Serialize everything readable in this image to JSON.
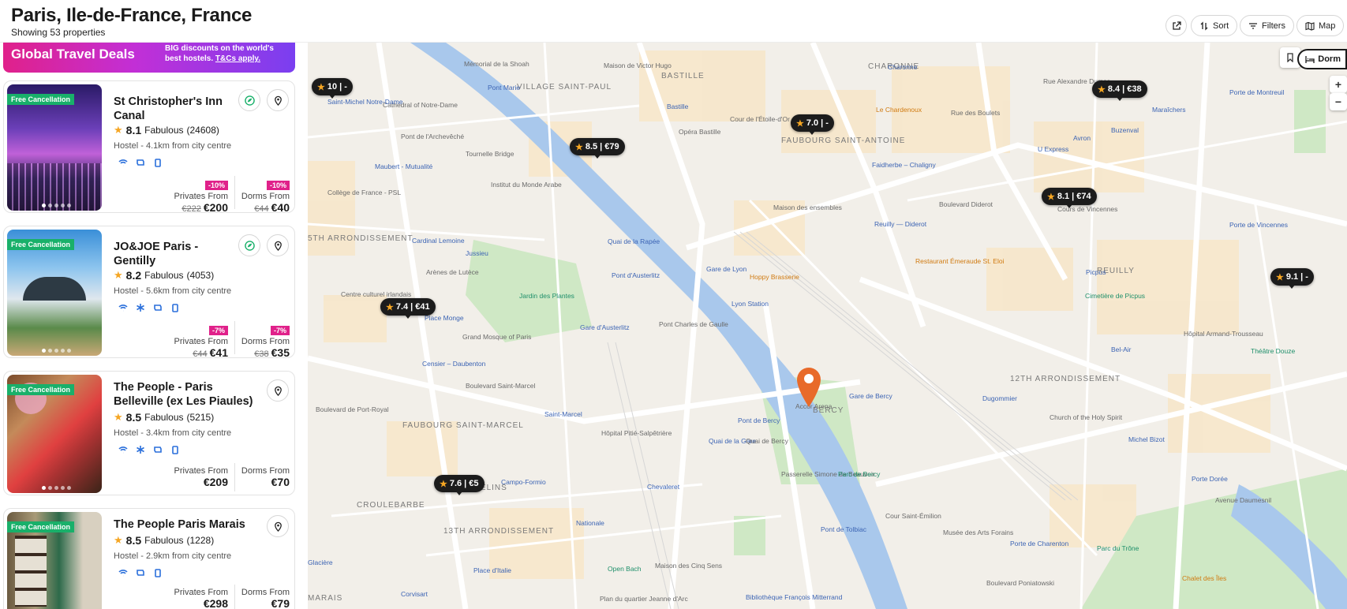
{
  "header": {
    "title": "Paris, Ile-de-France, France",
    "subtitle": "Showing 53 properties",
    "sort_label": "Sort",
    "filters_label": "Filters",
    "map_label": "Map"
  },
  "banner": {
    "headline": "Global Travel Deals",
    "text": "BIG discounts on the world's best hostels.",
    "link": "T&Cs apply."
  },
  "properties": [
    {
      "badge": "Free Cancellation",
      "name": "St Christopher's Inn Canal",
      "score": "8.1",
      "rating_word": "Fabulous",
      "reviews": "(24608)",
      "meta": "Hostel - 4.1km from city centre",
      "privates_discount": "-10%",
      "privates_label": "Privates From",
      "privates_old": "€222",
      "privates_price": "€200",
      "dorms_discount": "-10%",
      "dorms_label": "Dorms From",
      "dorms_old": "€44",
      "dorms_price": "€40"
    },
    {
      "badge": "Free Cancellation",
      "name": "JO&JOE Paris - Gentilly",
      "score": "8.2",
      "rating_word": "Fabulous",
      "reviews": "(4053)",
      "meta": "Hostel - 5.6km from city centre",
      "privates_discount": "-7%",
      "privates_label": "Privates From",
      "privates_old": "€44",
      "privates_price": "€41",
      "dorms_discount": "-7%",
      "dorms_label": "Dorms From",
      "dorms_old": "€38",
      "dorms_price": "€35"
    },
    {
      "badge": "Free Cancellation",
      "name": "The People - Paris Belleville (ex Les Piaules)",
      "score": "8.5",
      "rating_word": "Fabulous",
      "reviews": "(5215)",
      "meta": "Hostel - 3.4km from city centre",
      "privates_label": "Privates From",
      "privates_price": "€209",
      "dorms_label": "Dorms From",
      "dorms_price": "€70"
    },
    {
      "badge": "Free Cancellation",
      "name": "The People Paris Marais",
      "score": "8.5",
      "rating_word": "Fabulous",
      "reviews": "(1228)",
      "meta": "Hostel - 2.9km from city centre",
      "privates_label": "Privates From",
      "privates_price": "€298",
      "dorms_label": "Dorms From",
      "dorms_price": "€79"
    }
  ],
  "map": {
    "dorm_toggle": "Dorm",
    "zoom_in": "+",
    "zoom_out": "−",
    "pins": [
      {
        "score": "10",
        "price": "-"
      },
      {
        "score": "8.5",
        "price": "€79"
      },
      {
        "score": "7.0",
        "price": "-"
      },
      {
        "score": "8.4",
        "price": "€38"
      },
      {
        "score": "8.1",
        "price": "€74"
      },
      {
        "score": "9.1",
        "price": "-"
      },
      {
        "score": "7.4",
        "price": "€41"
      },
      {
        "score": "7.6",
        "price": "€5"
      }
    ],
    "areas": [
      "BASTILLE",
      "VILLAGE SAINT-PAUL",
      "FAUBOURG SAINT-ANTOINE",
      "CHARONNE",
      "REUILLY",
      "12TH ARRONDISSEMENT",
      "BERCY",
      "5TH ARRONDISSEMENT",
      "FAUBOURG SAINT-MARCEL",
      "CROULEBARBE",
      "LES GOBELINS",
      "13TH ARRONDISSEMENT",
      "MARAIS"
    ],
    "places": [
      "Mémorial de la Shoah",
      "Maison de Victor Hugo",
      "Pont Marie",
      "Cathedral of Notre-Dame",
      "Saint-Michel Notre-Dame",
      "Pont de l'Archevêché",
      "Tournelle Bridge",
      "Maubert - Mutualité",
      "Institut du Monde Arabe",
      "Collège de France - PSL",
      "Bastille",
      "Opéra Bastille",
      "Cour de l'Étoile-d'Or",
      "Le Chardenoux",
      "Rue des Boulets",
      "Charonne",
      "U Express",
      "Buzenval",
      "Maraîchers",
      "Porte de Montreuil",
      "Faidherbe – Chaligny",
      "Maison des ensembles",
      "Reuilly — Diderot",
      "Restaurant Émeraude St. Eloi",
      "Picpus",
      "Cimetière de Picpus",
      "Porte de Vincennes",
      "Gare de Lyon",
      "Hoppy Brasserie",
      "Lyon Station",
      "Quai de la Rapée",
      "Pont d'Austerlitz",
      "Jardin des Plantes",
      "Arènes de Lutèce",
      "Cardinal Lemoine",
      "Jussieu",
      "Place Monge",
      "Centre culturel irlandais",
      "Grand Mosque of Paris",
      "Censier – Daubenton",
      "Gare d'Austerlitz",
      "Pont Charles de Gaulle",
      "Saint-Marcel",
      "Hôpital Pitié-Salpêtrière",
      "Quai de la Gare",
      "Pont de Bercy",
      "Accor Arena",
      "Gare de Bercy",
      "Dugommier",
      "Church of the Holy Spirit",
      "Michel Bizot",
      "Hôpital Armand-Trousseau",
      "Bel-Air",
      "Théâtre Douze",
      "Porte Dorée",
      "Passerelle Simone de Beauvoir",
      "Parc de Bercy",
      "Cour Saint-Émilion",
      "Musée des Arts Forains",
      "Pont de Tolbiac",
      "Chevaleret",
      "Campo-Formio",
      "Nationale",
      "Place d'Italie",
      "Open Bach",
      "Maison des Cinq Sens",
      "Plan du quartier Jeanne d'Arc",
      "Bibliothèque François Mitterrand",
      "Porte de Charenton",
      "Parc du Trône",
      "Chalet des Îles",
      "Glacière",
      "Corvisart",
      "Rue Alexandre Dumas",
      "Boulevard Diderot",
      "Cours de Vincennes",
      "Avenue Daumesnil",
      "Boulevard Poniatowski",
      "Quai de Bercy",
      "Boulevard Saint-Marcel",
      "Boulevard de Port-Royal",
      "Avron"
    ]
  }
}
